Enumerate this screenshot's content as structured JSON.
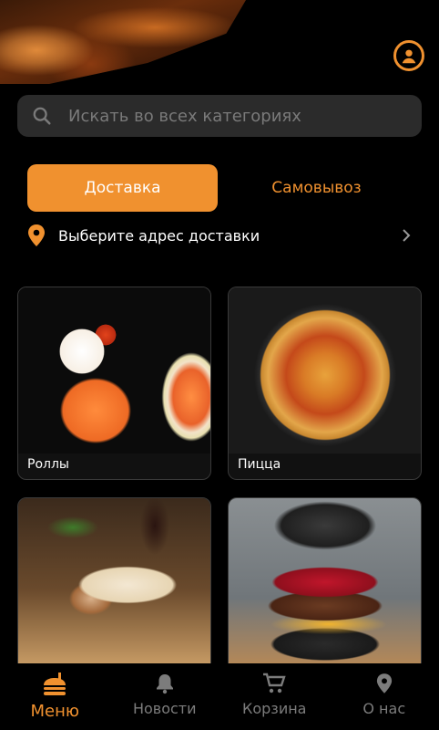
{
  "colors": {
    "accent": "#f0912f",
    "background": "#000000",
    "field": "#2b2b2b",
    "muted": "#7c7c7c"
  },
  "header": {
    "profile_icon": "user-circle-icon"
  },
  "search": {
    "icon": "search-icon",
    "placeholder": "Искать во всех категориях"
  },
  "delivery_tabs": [
    {
      "label": "Доставка",
      "selected": true
    },
    {
      "label": "Самовывоз",
      "selected": false
    }
  ],
  "address": {
    "icon": "location-pin-icon",
    "label": "Выберите адрес доставки",
    "chevron": "chevron-right-icon"
  },
  "categories": [
    {
      "name": "Роллы",
      "image": "rolls-image"
    },
    {
      "name": "Пицца",
      "image": "pizza-image"
    },
    {
      "name": "",
      "image": "shawarma-image"
    },
    {
      "name": "",
      "image": "burger-image"
    }
  ],
  "bottom_nav": [
    {
      "label": "Меню",
      "icon": "menu-food-icon",
      "active": true
    },
    {
      "label": "Новости",
      "icon": "bell-icon",
      "active": false
    },
    {
      "label": "Корзина",
      "icon": "cart-icon",
      "active": false
    },
    {
      "label": "О нас",
      "icon": "location-pin-icon",
      "active": false
    }
  ]
}
